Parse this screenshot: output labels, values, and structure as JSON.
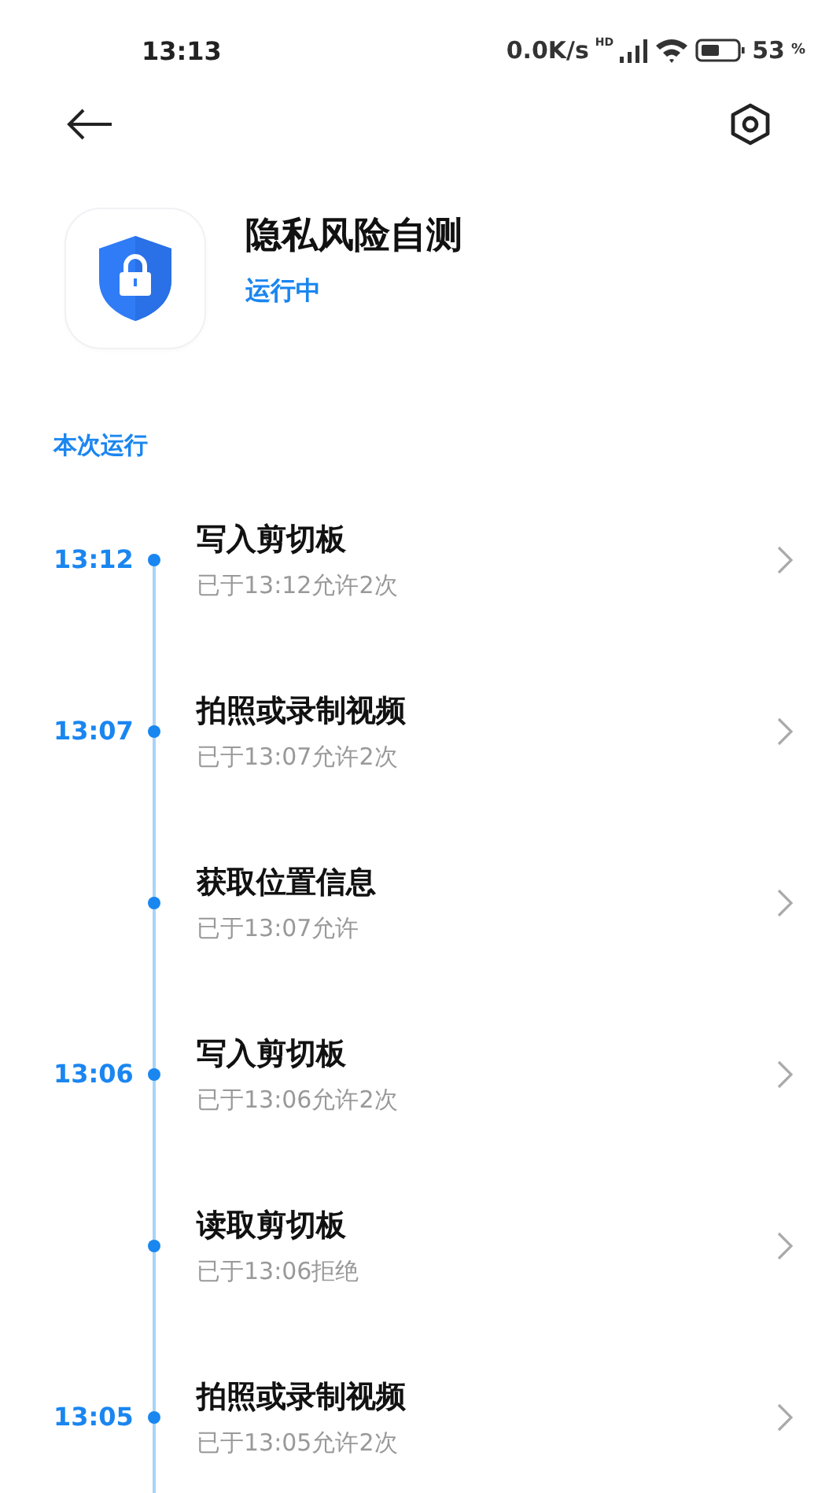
{
  "status_bar": {
    "time": "13:13",
    "net_speed": "0.0K/s",
    "network_tag": "HD",
    "battery": "53",
    "battery_unit": "%"
  },
  "app": {
    "name": "隐私风险自测",
    "status": "运行中"
  },
  "section_title": "本次运行",
  "events": [
    {
      "time": "13:12",
      "title": "写入剪切板",
      "detail": "已于13:12允许2次"
    },
    {
      "time": "13:07",
      "title": "拍照或录制视频",
      "detail": "已于13:07允许2次"
    },
    {
      "title": "获取位置信息",
      "detail": "已于13:07允许"
    },
    {
      "time": "13:06",
      "title": "写入剪切板",
      "detail": "已于13:06允许2次"
    },
    {
      "title": "读取剪切板",
      "detail": "已于13:06拒绝"
    },
    {
      "time": "13:05",
      "title": "拍照或录制视频",
      "detail": "已于13:05允许2次"
    }
  ]
}
